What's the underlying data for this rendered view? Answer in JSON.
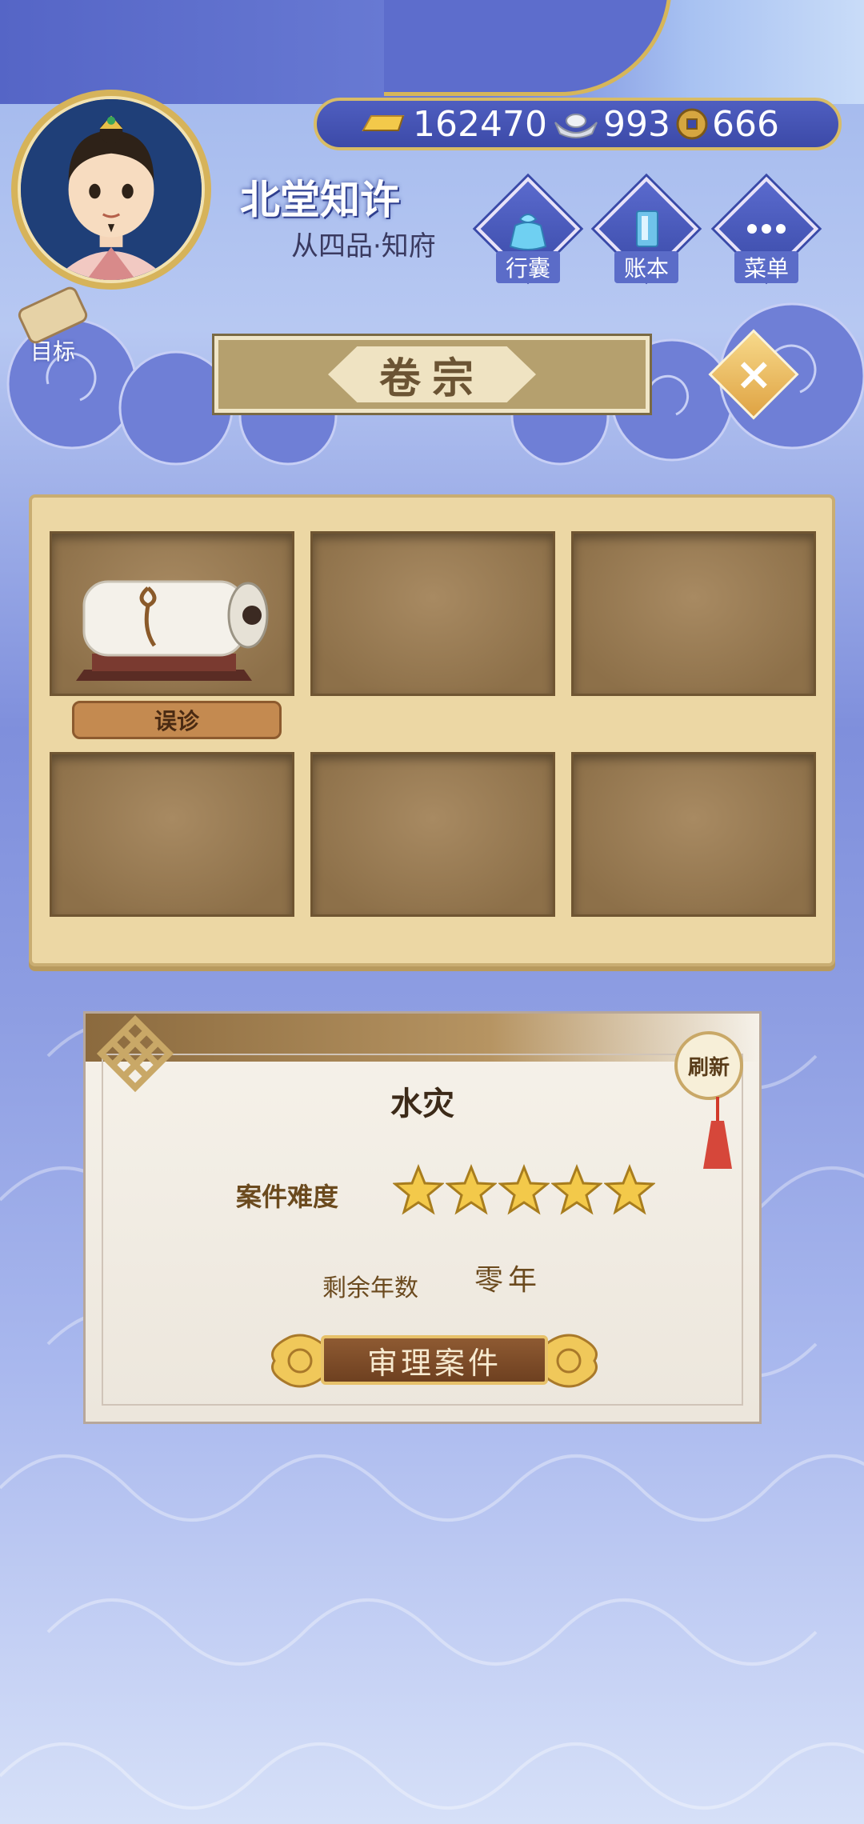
{
  "currencies": [
    {
      "icon": "gold-ingot-icon",
      "value": "162470"
    },
    {
      "icon": "silver-ingot-icon",
      "value": "993"
    },
    {
      "icon": "copper-coin-icon",
      "value": "666"
    }
  ],
  "player": {
    "name": "北堂知许",
    "rank": "从四品·知府"
  },
  "top_buttons": [
    {
      "id": "bag",
      "label": "行囊",
      "icon": "bag-icon"
    },
    {
      "id": "ledger",
      "label": "账本",
      "icon": "ledger-icon"
    },
    {
      "id": "menu",
      "label": "菜单",
      "icon": "menu-dots-icon"
    }
  ],
  "goal": {
    "label": "目标",
    "icon": "scroll-icon"
  },
  "title": "卷宗",
  "shelf": {
    "slots": [
      {
        "label": "误诊",
        "has_item": true
      },
      {
        "label": "",
        "has_item": false
      },
      {
        "label": "",
        "has_item": false
      },
      {
        "label": "",
        "has_item": false
      },
      {
        "label": "",
        "has_item": false
      },
      {
        "label": "",
        "has_item": false
      }
    ]
  },
  "case": {
    "title": "水灾",
    "difficulty_label": "案件难度",
    "difficulty_stars": 5,
    "difficulty_max": 5,
    "years_label": "剩余年数",
    "years_value": "零年",
    "refresh_label": "刷新",
    "action_label": "审理案件"
  },
  "colors": {
    "accent": "#d8bc66",
    "star": "#f3c94a",
    "button": "#6e4020"
  }
}
